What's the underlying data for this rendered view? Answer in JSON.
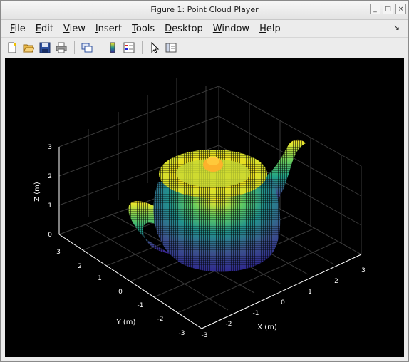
{
  "window": {
    "title": "Figure 1: Point Cloud Player"
  },
  "menu": [
    "File",
    "Edit",
    "View",
    "Insert",
    "Tools",
    "Desktop",
    "Window",
    "Help"
  ],
  "toolbar": [
    "new-figure-icon",
    "open-file-icon",
    "save-icon",
    "print-icon",
    "link-plot-icon",
    "colorbar-icon",
    "legend-icon",
    "select-arrow-icon",
    "property-inspector-icon"
  ],
  "colors": {
    "background": "#000000",
    "axis": "#ffffff",
    "grid": "#3a3a3a",
    "colormap": [
      "#440154",
      "#3b528b",
      "#21918c",
      "#5ec962",
      "#fde725"
    ]
  },
  "axes": {
    "xlabel": "X (m)",
    "ylabel": "Y (m)",
    "zlabel": "Z (m)",
    "x_ticks": [
      "-3",
      "-2",
      "-1",
      "0",
      "1",
      "2",
      "3"
    ],
    "y_ticks": [
      "3",
      "2",
      "1",
      "0",
      "-1",
      "-2",
      "-3"
    ],
    "z_ticks": [
      "0",
      "1",
      "2",
      "3"
    ]
  }
}
